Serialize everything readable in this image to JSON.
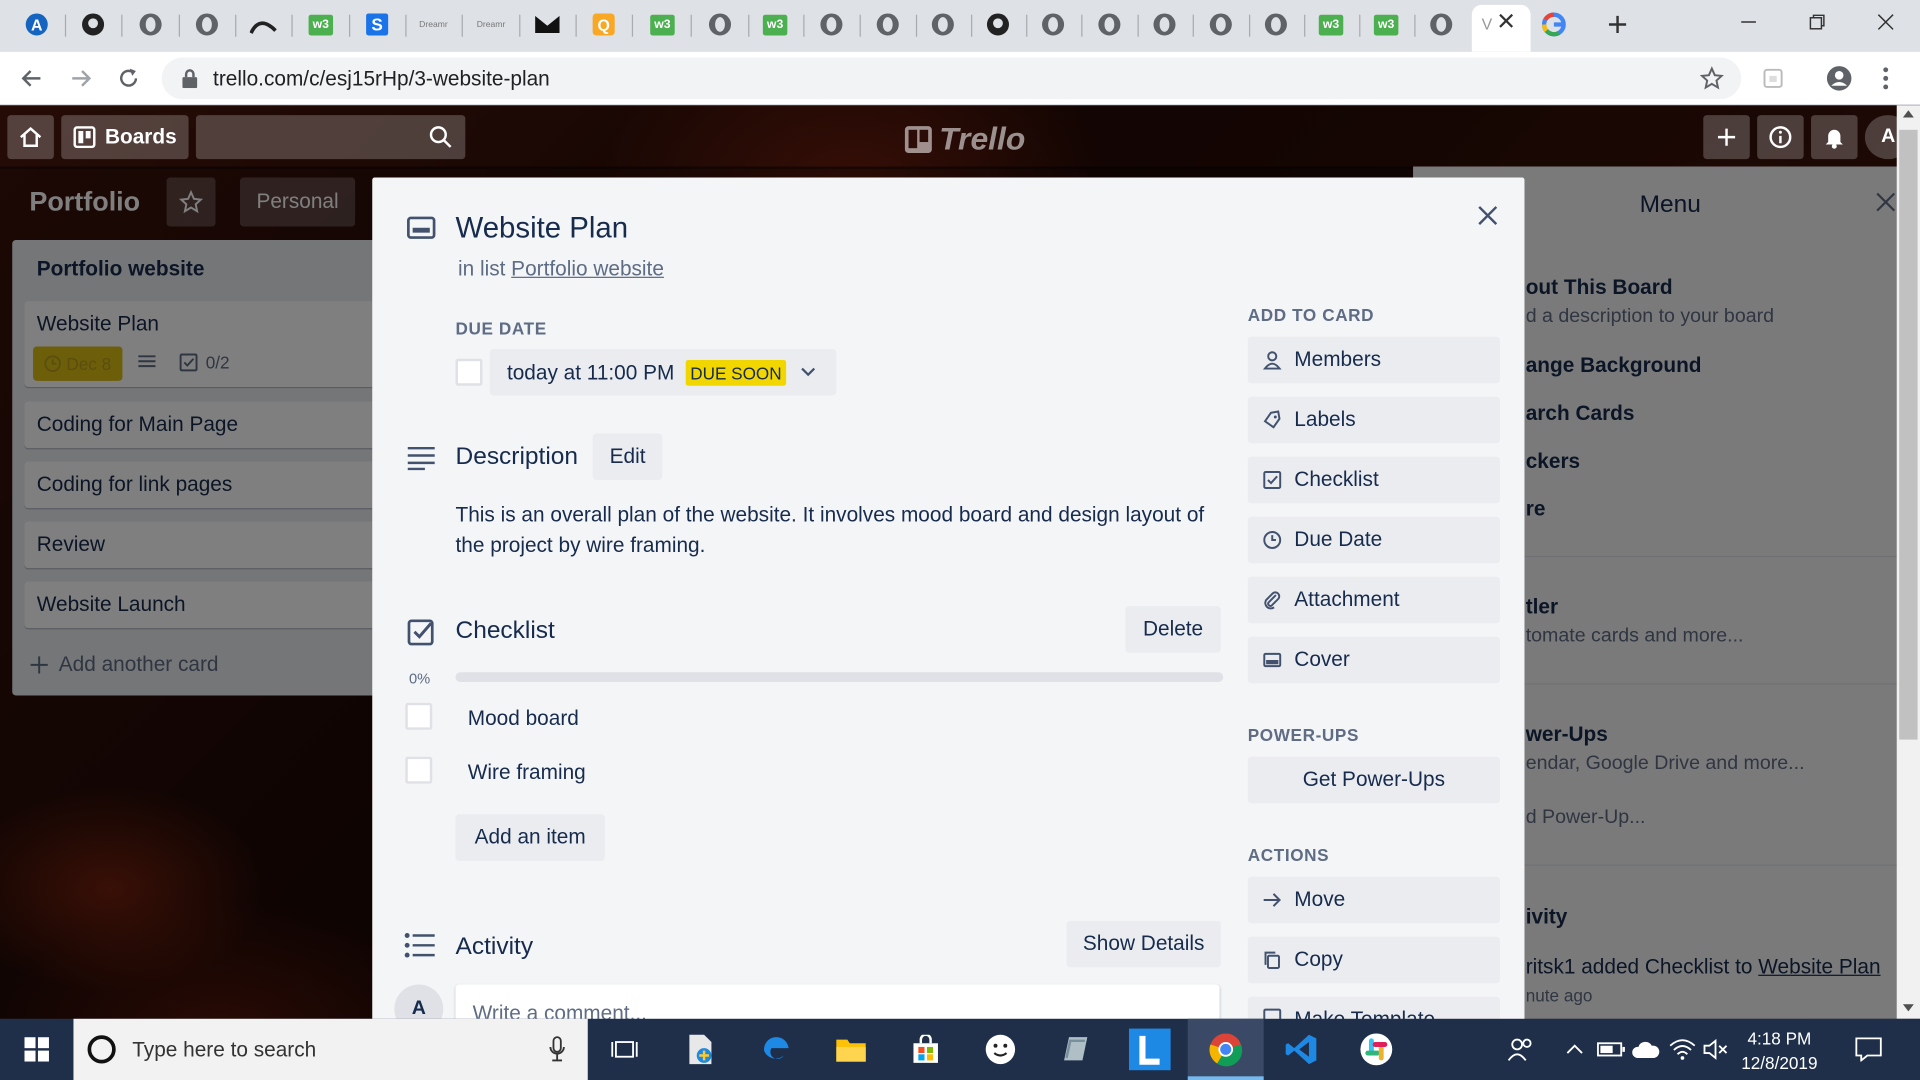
{
  "browser": {
    "url": "trello.com/c/esj15rHp/3-website-plan",
    "active_tab_label": "V",
    "tab_icons": [
      "a-icon",
      "github-icon",
      "globe-icon",
      "globe-icon",
      "mountain-icon",
      "w3-icon",
      "s-icon",
      "small-icon",
      "small-icon",
      "envelope-icon",
      "q-icon",
      "w3-icon",
      "globe-icon",
      "w3-icon",
      "globe-icon",
      "globe-icon",
      "globe-icon",
      "github-icon",
      "globe-icon",
      "globe-icon",
      "globe-icon",
      "globe-icon",
      "globe-icon",
      "w3-icon",
      "w3-icon",
      "globe-icon"
    ],
    "w3_label": "w3",
    "s_label": "S",
    "q_label": "Q",
    "small_label": "Dreamr"
  },
  "trello": {
    "header": {
      "boards_label": "Boards",
      "logo_text": "Trello",
      "avatar_initial": "A"
    },
    "board": {
      "title": "Portfolio",
      "visibility": "Personal"
    },
    "list": {
      "title": "Portfolio website",
      "cards": [
        {
          "title": "Website Plan",
          "due": "Dec 8",
          "checklist": "0/2"
        },
        {
          "title": "Coding for Main Page"
        },
        {
          "title": "Coding for link pages"
        },
        {
          "title": "Review"
        },
        {
          "title": "Website Launch"
        }
      ],
      "add_card_label": "Add another card"
    },
    "menu": {
      "title": "Menu",
      "items": [
        {
          "label": "out This Board",
          "sub": "d a description to your board"
        },
        {
          "label": "ange Background"
        },
        {
          "label": "arch Cards"
        },
        {
          "label": "ckers"
        },
        {
          "label": "re"
        },
        {
          "label": "tler",
          "sub": "tomate cards and more..."
        },
        {
          "label": "wer-Ups",
          "sub": "endar, Google Drive and more..."
        },
        {
          "sub": "d Power-Up..."
        },
        {
          "label": "ivity"
        }
      ],
      "activity": {
        "text": "ritsk1 added Checklist to ",
        "link": "Website Plan",
        "time": "nute ago"
      }
    }
  },
  "card_modal": {
    "title": "Website Plan",
    "in_list_prefix": "in list ",
    "in_list_link": "Portfolio website",
    "due_date": {
      "label": "DUE DATE",
      "value": "today at 11:00 PM",
      "badge": "DUE SOON"
    },
    "description": {
      "heading": "Description",
      "edit_label": "Edit",
      "text": "This is an overall plan of the website. It involves mood board and design layout of the project by wire framing."
    },
    "checklist": {
      "heading": "Checklist",
      "delete_label": "Delete",
      "progress_label": "0%",
      "progress": 0,
      "items": [
        {
          "text": "Mood board",
          "checked": false
        },
        {
          "text": "Wire framing",
          "checked": false
        }
      ],
      "add_item_label": "Add an item"
    },
    "activity": {
      "heading": "Activity",
      "show_details_label": "Show Details",
      "avatar_initial": "A",
      "comment_placeholder": "Write a comment..."
    },
    "sidebar": {
      "add_to_card_label": "ADD TO CARD",
      "add_to_card": [
        "Members",
        "Labels",
        "Checklist",
        "Due Date",
        "Attachment",
        "Cover"
      ],
      "power_ups_label": "POWER-UPS",
      "get_power_ups": "Get Power-Ups",
      "actions_label": "ACTIONS",
      "actions": [
        "Move",
        "Copy",
        "Make Template"
      ]
    }
  },
  "taskbar": {
    "search_placeholder": "Type here to search",
    "time": "4:18 PM",
    "date": "12/8/2019"
  },
  "colors": {
    "due_soon": "#f2d600",
    "card_due_badge": "#dabd14",
    "taskbar": "#1f2f4a"
  }
}
